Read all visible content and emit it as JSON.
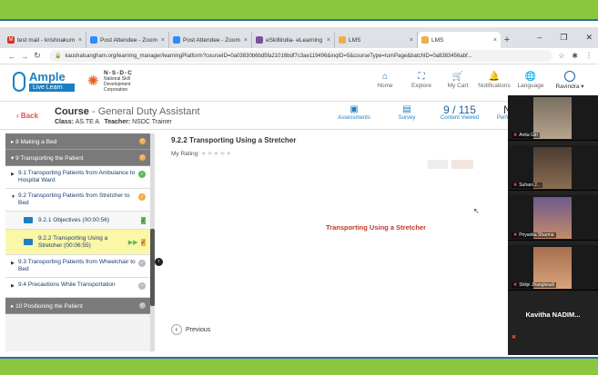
{
  "browser": {
    "tabs": [
      {
        "label": "test mail - krishnakum",
        "icon": "gmail-icon",
        "color": "#d93025"
      },
      {
        "label": "Post Attendee - Zoom",
        "icon": "zoom-icon",
        "color": "#2d8cff"
      },
      {
        "label": "Post Attendee - Zoom",
        "icon": "zoom-icon",
        "color": "#2d8cff"
      },
      {
        "label": "eSkillindia- eLearning",
        "icon": "eskill-icon",
        "color": "#7a4fa0"
      },
      {
        "label": "LMS",
        "icon": "lms-icon",
        "color": "#f0ad4e"
      },
      {
        "label": "LMS",
        "icon": "lms-icon",
        "color": "#f0ad4e",
        "active": true
      }
    ],
    "url": "kaushalsangham.org/learning_manager/learningPlatform?courseID=0a03830b6bd5fa21016bdf7c3ae119496&inqID=5&courseType=turnPage&batchID=0a8383456abf..."
  },
  "site": {
    "brand": "Ample",
    "brand_tag": "Live Learn",
    "partner": "N-S-D-C",
    "partner_sub": "National Skill Development Corporation",
    "nav": [
      {
        "label": "Home",
        "icon": "home-icon"
      },
      {
        "label": "Explore",
        "icon": "explore-icon"
      },
      {
        "label": "My Cart",
        "icon": "cart-icon"
      },
      {
        "label": "Notifications",
        "icon": "bell-icon"
      },
      {
        "label": "Language",
        "icon": "language-icon"
      }
    ],
    "user": "Ravindra"
  },
  "course": {
    "back": "Back",
    "label": "Course",
    "name": "- General Duty Assistant",
    "class_label": "Class:",
    "class": "AS.TE A",
    "teacher_label": "Teacher:",
    "teacher": "NSDC Trainer",
    "stats": [
      {
        "label": "Assessments",
        "icon": "assessment-icon"
      },
      {
        "label": "Survey",
        "icon": "survey-icon"
      },
      {
        "label": "Content Viewed",
        "value": "9 / 115"
      },
      {
        "label": "Performance",
        "value": "N/A"
      }
    ]
  },
  "sidebar": {
    "sections": [
      {
        "label": "8 Making a Bed",
        "status": "in-progress"
      },
      {
        "label": "9 Transporting the Patient",
        "status": "in-progress"
      }
    ],
    "items": [
      {
        "label": "9.1 Transporting Patients from Ambulance to Hospital Ward",
        "status": "complete"
      },
      {
        "label": "9.2 Transporting Patients from Stretcher to Bed",
        "status": "in-progress"
      }
    ],
    "subitems": [
      {
        "label": "9.2.1 Objectives (00:00:56)",
        "status": "complete"
      },
      {
        "label": "9.2.2 Transporting Using a Stretcher (00:06:55)",
        "status": "in-progress"
      }
    ],
    "items2": [
      {
        "label": "9.3 Transporting Patients from Wheelchair to Bed",
        "status": "not-started"
      },
      {
        "label": "9.4 Precautions While Transportation",
        "status": "not-started"
      }
    ],
    "section_last": {
      "label": "10 Positioning the Patient",
      "status": "not-started"
    }
  },
  "content": {
    "lesson_title": "9.2.2 Transporting Using a Stretcher",
    "rating_label": "My Rating:",
    "slide_title": "Transporting Using a Stretcher",
    "previous": "Previous"
  },
  "zoom": {
    "participants": [
      {
        "name": "Anita Giri"
      },
      {
        "name": "Suhani J..."
      },
      {
        "name": "Priyanka Sharma"
      },
      {
        "name": "Shilpi Jhangiwadi"
      }
    ],
    "speaker": "Kavitha NADIM..."
  },
  "colors": {
    "accent_green": "#8cc63f",
    "brand_blue": "#1d7fc2",
    "alert_red": "#c0392b"
  }
}
